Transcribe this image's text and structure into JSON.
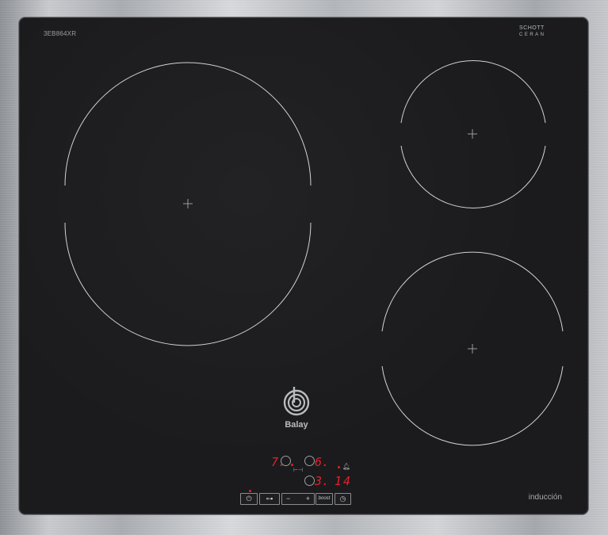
{
  "appliance": {
    "model": "3EB864XR",
    "glass_brand_line1": "SCHOTT",
    "glass_brand_line2": "CERAN",
    "glass_brand_code": "",
    "brand_name": "Balay",
    "type_label": "inducción"
  },
  "cooking_zones": [
    {
      "id": "large-left"
    },
    {
      "id": "small-top-right"
    },
    {
      "id": "medium-bottom-right"
    }
  ],
  "control_panel": {
    "zone_left_level": "7.",
    "zone_right_level": "6.",
    "zone_third_level": "3.",
    "timer_value": "14",
    "buttons": {
      "power_symbol": "⏻",
      "lock_symbol": "⊶",
      "minus_symbol": "−",
      "plus_symbol": "+",
      "boost_label": "boost",
      "timer_symbol": "◷"
    }
  },
  "colors": {
    "glass": "#1b1b1d",
    "led_red": "#e3202a",
    "ring": "#d0d2d5"
  }
}
